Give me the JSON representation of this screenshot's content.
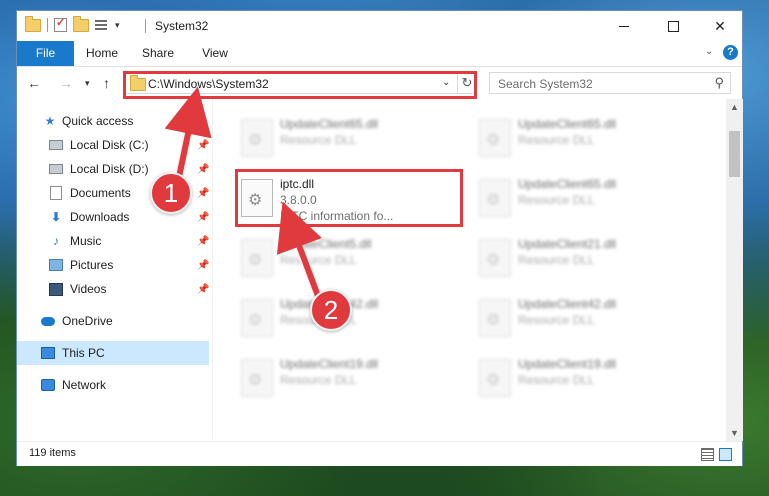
{
  "window": {
    "title": "System32"
  },
  "ribbon": {
    "tabs": [
      {
        "label": "File"
      },
      {
        "label": "Home"
      },
      {
        "label": "Share"
      },
      {
        "label": "View"
      }
    ]
  },
  "navbar": {
    "address": "C:\\Windows\\System32",
    "search_placeholder": "Search System32"
  },
  "sidebar": {
    "items": [
      {
        "label": "Quick access",
        "icon": "star-icon"
      },
      {
        "label": "Local Disk (C:)",
        "icon": "drive-icon",
        "pinned": true
      },
      {
        "label": "Local Disk (D:)",
        "icon": "drive-icon",
        "pinned": true
      },
      {
        "label": "Documents",
        "icon": "documents-icon",
        "pinned": true
      },
      {
        "label": "Downloads",
        "icon": "downloads-icon",
        "pinned": true
      },
      {
        "label": "Music",
        "icon": "music-icon",
        "pinned": true
      },
      {
        "label": "Pictures",
        "icon": "pictures-icon",
        "pinned": true
      },
      {
        "label": "Videos",
        "icon": "videos-icon",
        "pinned": true
      },
      {
        "label": "OneDrive",
        "icon": "cloud-icon"
      },
      {
        "label": "This PC",
        "icon": "computer-icon",
        "selected": true
      },
      {
        "label": "Network",
        "icon": "network-icon"
      }
    ]
  },
  "files": {
    "left_column": [
      {
        "name": "UpdateClient65.dll",
        "desc": "Resource DLL"
      },
      {
        "name": "iptc.dll",
        "desc": "3.8.0.0",
        "desc2": "IPTC information fo..."
      },
      {
        "name": "UpdateClient5.dll",
        "desc": "Resource DLL"
      },
      {
        "name": "UpdateClient42.dll",
        "desc": "Resource DLL"
      },
      {
        "name": "UpdateClient19.dll",
        "desc": "Resource DLL"
      }
    ],
    "right_column": [
      {
        "name": "UpdateClient65.dll",
        "desc": "Resource DLL"
      },
      {
        "name": "UpdateClient65.dll",
        "desc": "Resource DLL"
      },
      {
        "name": "UpdateClient21.dll",
        "desc": "Resource DLL"
      },
      {
        "name": "UpdateClient42.dll",
        "desc": "Resource DLL"
      },
      {
        "name": "UpdateClient19.dll",
        "desc": "Resource DLL"
      }
    ]
  },
  "status": {
    "item_count": "119 items"
  },
  "callouts": [
    {
      "number": "1"
    },
    {
      "number": "2"
    }
  ],
  "colors": {
    "accent": "#1979ca",
    "highlight": "#e0393e",
    "selection": "#cce8ff"
  }
}
